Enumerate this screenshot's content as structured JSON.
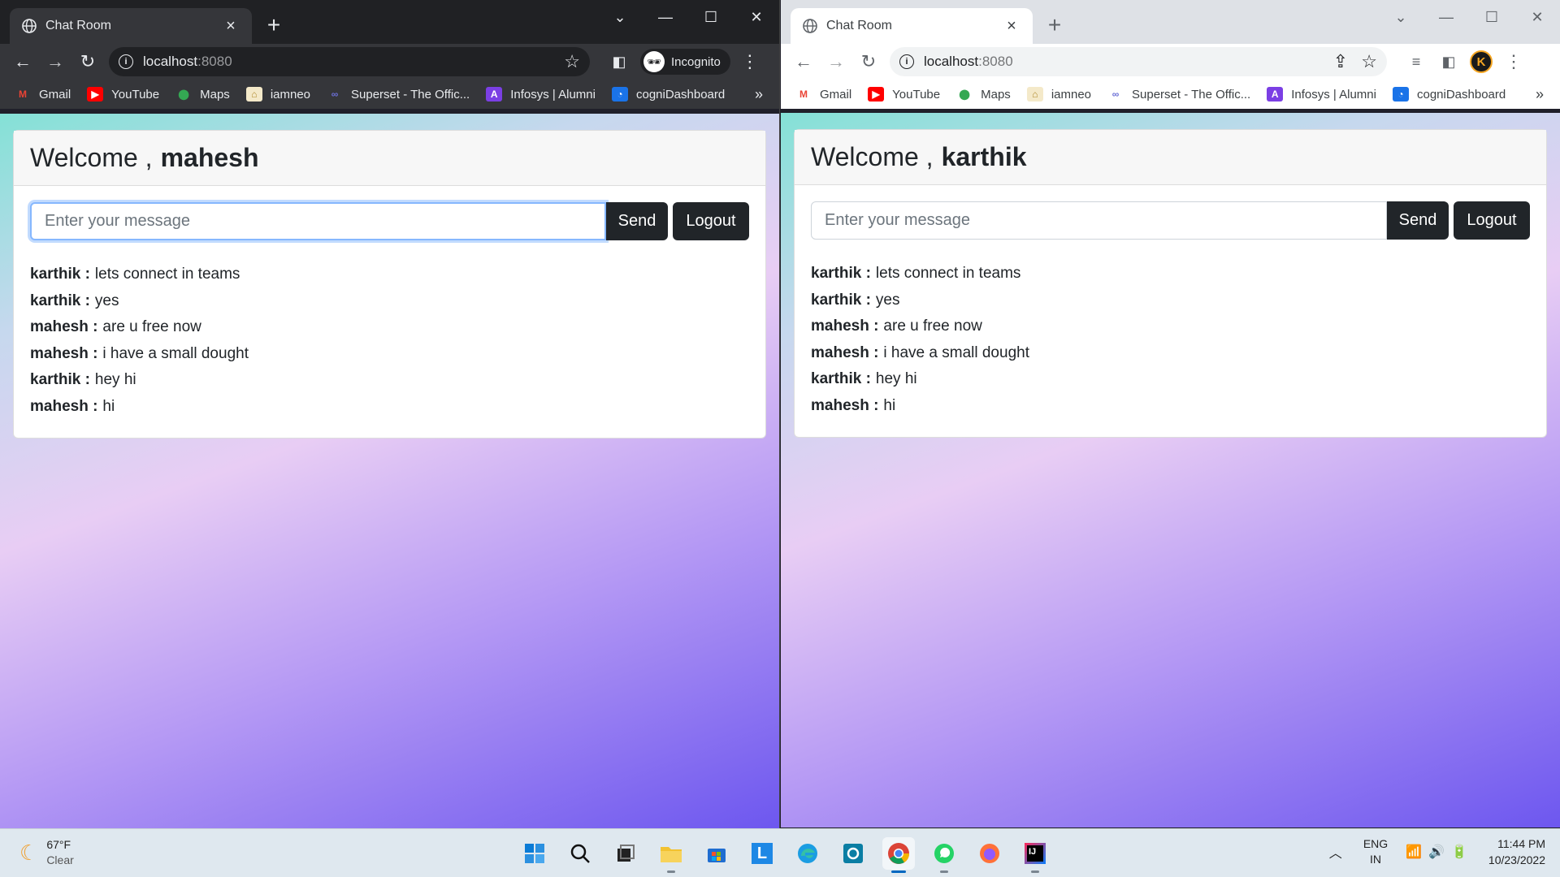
{
  "browser_common": {
    "bookmarks": [
      {
        "label": "Gmail",
        "icon": "gmail-icon"
      },
      {
        "label": "YouTube",
        "icon": "youtube-icon"
      },
      {
        "label": "Maps",
        "icon": "maps-icon"
      },
      {
        "label": "iamneo",
        "icon": "iamneo-icon"
      },
      {
        "label": "Superset - The Offic...",
        "icon": "superset-icon"
      },
      {
        "label": "Infosys | Alumni",
        "icon": "infosys-icon"
      },
      {
        "label": "cogniDashboard",
        "icon": "cogni-icon"
      }
    ],
    "bookmarks_more": "»",
    "url_host": "localhost",
    "url_port": ":8080"
  },
  "left": {
    "tab_title": "Chat Room",
    "incognito_label": "Incognito",
    "welcome_prefix": "Welcome ,",
    "username": "mahesh",
    "input_placeholder": "Enter your message",
    "send_label": "Send",
    "logout_label": "Logout",
    "messages": [
      {
        "user": "karthik :",
        "text": "lets connect in teams"
      },
      {
        "user": "karthik :",
        "text": "yes"
      },
      {
        "user": "mahesh :",
        "text": "are u free now"
      },
      {
        "user": "mahesh :",
        "text": "i have a small dought"
      },
      {
        "user": "karthik :",
        "text": "hey hi"
      },
      {
        "user": "mahesh :",
        "text": "hi"
      }
    ]
  },
  "right": {
    "tab_title": "Chat Room",
    "profile_initial": "K",
    "welcome_prefix": "Welcome ,",
    "username": "karthik",
    "input_placeholder": "Enter your message",
    "send_label": "Send",
    "logout_label": "Logout",
    "messages": [
      {
        "user": "karthik :",
        "text": "lets connect in teams"
      },
      {
        "user": "karthik :",
        "text": "yes"
      },
      {
        "user": "mahesh :",
        "text": "are u free now"
      },
      {
        "user": "mahesh :",
        "text": "i have a small dought"
      },
      {
        "user": "karthik :",
        "text": "hey hi"
      },
      {
        "user": "mahesh :",
        "text": "hi"
      }
    ]
  },
  "taskbar": {
    "weather_temp": "67°F",
    "weather_cond": "Clear",
    "lang_1": "ENG",
    "lang_2": "IN",
    "time": "11:44 PM",
    "date": "10/23/2022",
    "apps": [
      "start-icon",
      "search-icon",
      "task-view-icon",
      "file-explorer-icon",
      "store-icon",
      "l-app-icon",
      "edge-icon",
      "cortana-icon",
      "chrome-icon",
      "whatsapp-icon",
      "firefox-icon",
      "intellij-icon"
    ]
  },
  "colors": {
    "gradient": [
      "#84e1d6",
      "#e8cdf4",
      "#6d57ef"
    ],
    "button_dark": "#212529",
    "focus_ring": "#86b7fe"
  }
}
